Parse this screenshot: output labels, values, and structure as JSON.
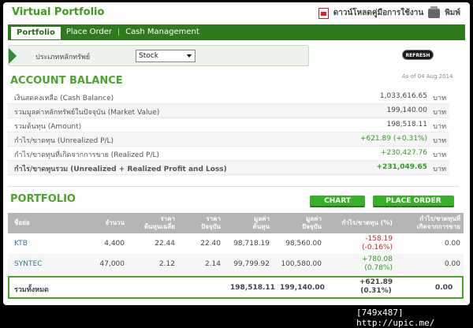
{
  "window": {
    "title": "Virtual Portfolio",
    "download_manual": "ดาวน์โหลดคู่มือการใช้งาน",
    "print_label": "พิมพ์"
  },
  "nav": {
    "items": [
      "Portfolio",
      "Place Order",
      "Cash Management"
    ]
  },
  "asset_filter": {
    "label": "ประเภทหลักทรัพย์",
    "selected": "Stock",
    "refresh_label": "REFRESH"
  },
  "account_balance": {
    "title": "ACCOUNT BALANCE",
    "as_of": "As of 04 Aug 2014",
    "unit": "บาท",
    "rows": [
      {
        "label": "เงินสดคงเหลือ (Cash Balance)",
        "value": "1,033,616.65"
      },
      {
        "label": "รวมมูลค่าหลักทรัพย์ในปัจจุบัน (Market Value)",
        "value": "199,140.00"
      },
      {
        "label": "รวมต้นทุน (Amount)",
        "value": "198,518.11"
      },
      {
        "label": "กำไร/ขาดทุน (Unrealized P/L)",
        "value": "+621.89 (+0.31%)"
      },
      {
        "label": "กำไร/ขาดทุนที่เกิดจากการขาย (Realized P/L)",
        "value": "+230,427.76"
      },
      {
        "label": "กำไร/ขาดทุนรวม (Unrealized + Realized Profit and Loss)",
        "value": "+231,049.65"
      }
    ]
  },
  "portfolio": {
    "title": "PORTFOLIO",
    "chart_button": "CHART",
    "place_order_button": "PLACE ORDER",
    "columns": [
      "ชื่อย่อ",
      "จำนวน",
      "ราคา\nต้นทุนเฉลี่ย",
      "ราคา\nปัจจุบัน",
      "มูลค่า\nต้นทุน",
      "มูลค่า\nปัจจุบัน",
      "กำไร/ขาดทุน (%)",
      "กำไร/ขาดทุนที่\nเกิดจากการขาย"
    ],
    "rows": [
      {
        "symbol": "KTB",
        "qty": "4,400",
        "avg_cost": "22.44",
        "price": "22.40",
        "cost_value": "98,718.19",
        "market_value": "98,560.00",
        "pl": "-158.19",
        "pl_pct": "(-0.16%)",
        "realized": "0.00"
      },
      {
        "symbol": "SYNTEC",
        "qty": "47,000",
        "avg_cost": "2.12",
        "price": "2.14",
        "cost_value": "99,799.92",
        "market_value": "100,580.00",
        "pl": "+780.08",
        "pl_pct": "(0.78%)",
        "realized": "0.00"
      }
    ],
    "total": {
      "label": "รวมทั้งหมด",
      "cost_value": "198,518.11",
      "market_value": "199,140.00",
      "pl": "+621.89",
      "pl_pct": "(0.31%)",
      "realized": "0.00"
    }
  },
  "watermark": "[749x487] http://upic.me/"
}
